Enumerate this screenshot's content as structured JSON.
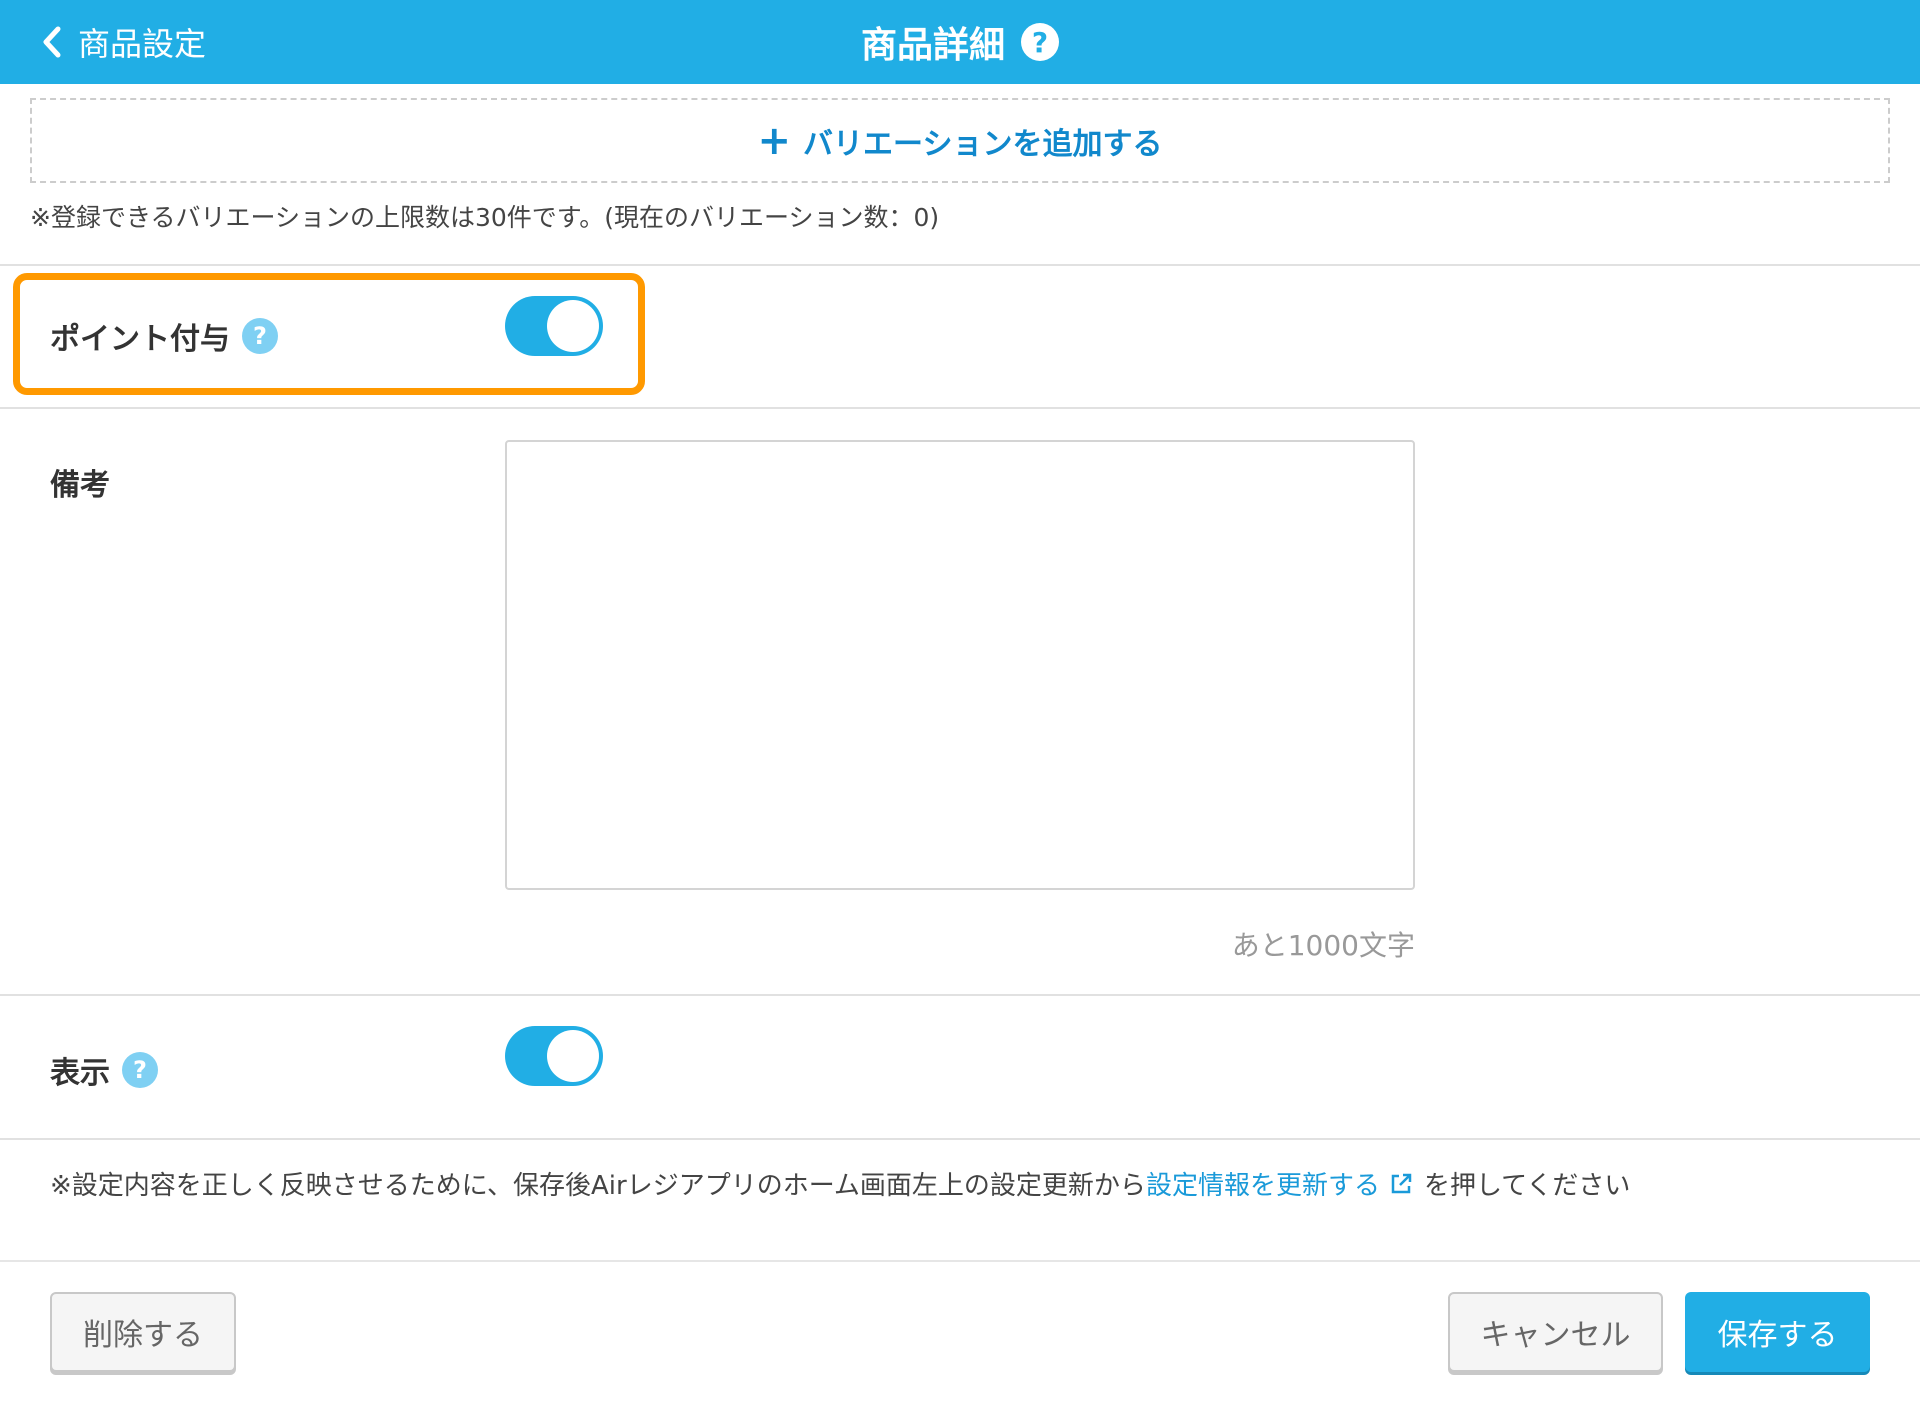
{
  "header": {
    "back_label": "商品設定",
    "title": "商品詳細",
    "help_glyph": "?"
  },
  "variation": {
    "add_plus": "+",
    "add_label": "バリエーションを追加する",
    "note": "※登録できるバリエーションの上限数は30件です。(現在のバリエーション数：0)"
  },
  "point": {
    "label": "ポイント付与",
    "help_glyph": "?",
    "enabled": true
  },
  "memo": {
    "label": "備考",
    "value": "",
    "remaining": "あと1000文字"
  },
  "display": {
    "label": "表示",
    "help_glyph": "?",
    "enabled": true
  },
  "footer_note": {
    "prefix": "※設定内容を正しく反映させるために、保存後Airレジアプリのホーム画面左上の設定更新から",
    "link": "設定情報を更新する",
    "suffix": "を押してください"
  },
  "buttons": {
    "delete": "削除する",
    "cancel": "キャンセル",
    "save": "保存する"
  },
  "colors": {
    "header": "#21aee5",
    "highlight": "#ff9900",
    "link": "#1a9ad9"
  }
}
